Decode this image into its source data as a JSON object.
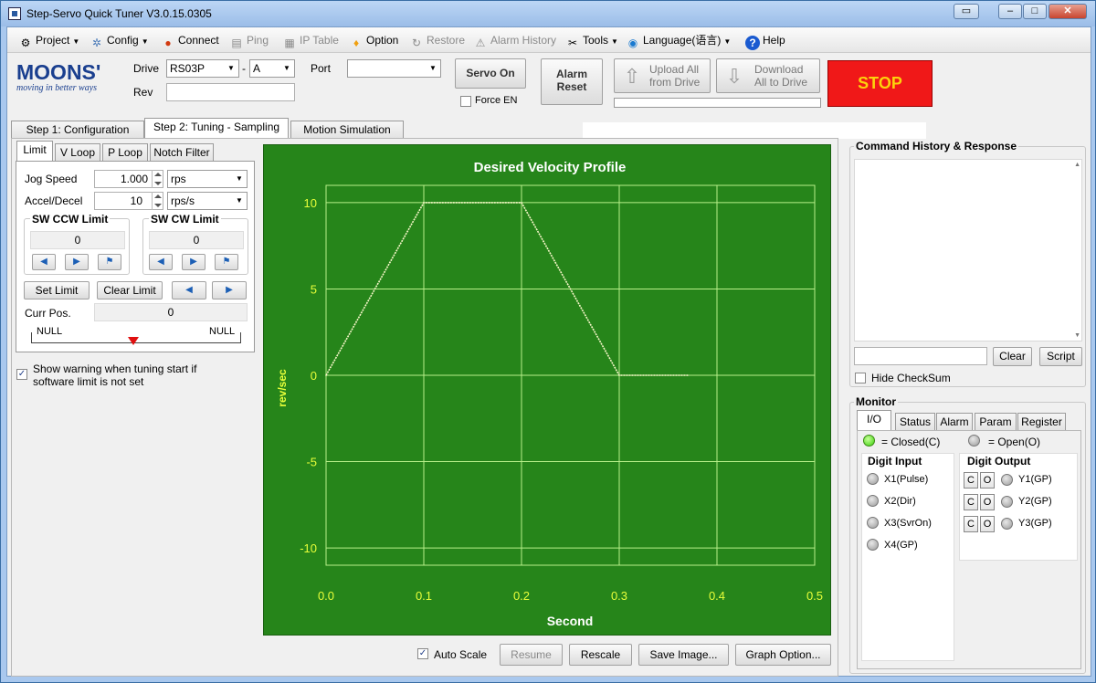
{
  "window": {
    "title": "Step-Servo Quick Tuner V3.0.15.0305"
  },
  "menu": {
    "project": "Project",
    "config": "Config",
    "connect": "Connect",
    "ping": "Ping",
    "ip_table": "IP Table",
    "option": "Option",
    "restore": "Restore",
    "alarm_history": "Alarm History",
    "tools": "Tools",
    "language": "Language(语言)",
    "help": "Help"
  },
  "logo": {
    "brand": "MOONS'",
    "tagline": "moving in better ways"
  },
  "drive": {
    "label": "Drive",
    "model": "RS03P",
    "sep": "-",
    "variant": "A",
    "rev_label": "Rev",
    "rev_value": ""
  },
  "port": {
    "label": "Port",
    "value": ""
  },
  "buttons": {
    "servo_on": "Servo On",
    "force_en": "Force EN",
    "alarm_reset_1": "Alarm",
    "alarm_reset_2": "Reset",
    "upload_1": "Upload All",
    "upload_2": "from Drive",
    "download_1": "Download",
    "download_2": "All to Drive",
    "stop": "STOP"
  },
  "main_tabs": [
    "Step 1: Configuration",
    "Step 2: Tuning - Sampling",
    "Motion Simulation"
  ],
  "sub_tabs": [
    "Limit",
    "V Loop",
    "P Loop",
    "Notch Filter"
  ],
  "limit": {
    "jog_speed_label": "Jog Speed",
    "jog_speed_value": "1.000",
    "jog_speed_unit": "rps",
    "accel_label": "Accel/Decel",
    "accel_value": "10",
    "accel_unit": "rps/s",
    "ccw_title": "SW CCW Limit",
    "ccw_value": "0",
    "cw_title": "SW CW Limit",
    "cw_value": "0",
    "set_limit": "Set Limit",
    "clear_limit": "Clear Limit",
    "curr_pos_label": "Curr Pos.",
    "curr_pos_value": "0",
    "null_left": "NULL",
    "null_right": "NULL"
  },
  "warning": {
    "line1": "Show warning when tuning start if",
    "line2": "software limit is not set"
  },
  "chart_data": {
    "type": "line",
    "title": "Desired Velocity Profile",
    "xlabel": "Second",
    "ylabel": "rev/sec",
    "xlim": [
      0,
      0.5
    ],
    "ylim": [
      -11,
      11
    ],
    "grid": true,
    "x_ticks": [
      "0.0",
      "0.1",
      "0.2",
      "0.3",
      "0.4",
      "0.5"
    ],
    "y_ticks": [
      "10",
      "5",
      "0",
      "-5",
      "-10"
    ],
    "series": [
      {
        "x": [
          0.0,
          0.1,
          0.2,
          0.3,
          0.37
        ],
        "values": [
          0,
          10,
          10,
          0,
          0
        ]
      }
    ],
    "colors": {
      "background": "#26851a",
      "grid": "#b8f08a",
      "line": "#f6f6c8",
      "text": "#e8ff3a"
    }
  },
  "chart_buttons": {
    "auto_scale": "Auto Scale",
    "resume": "Resume",
    "rescale": "Rescale",
    "save_image": "Save Image...",
    "graph_option": "Graph Option..."
  },
  "command": {
    "title": "Command History & Response",
    "clear": "Clear",
    "script": "Script",
    "hide_checksum": "Hide CheckSum"
  },
  "monitor": {
    "title": "Monitor",
    "tabs": [
      "I/O",
      "Status",
      "Alarm",
      "Param",
      "Register"
    ],
    "closed_legend": "= Closed(C)",
    "open_legend": "= Open(O)",
    "digit_input_title": "Digit Input",
    "digit_output_title": "Digit Output",
    "inputs": [
      "X1(Pulse)",
      "X2(Dir)",
      "X3(SvrOn)",
      "X4(GP)"
    ],
    "outputs": [
      "Y1(GP)",
      "Y2(GP)",
      "Y3(GP)"
    ],
    "c": "C",
    "o": "O"
  }
}
